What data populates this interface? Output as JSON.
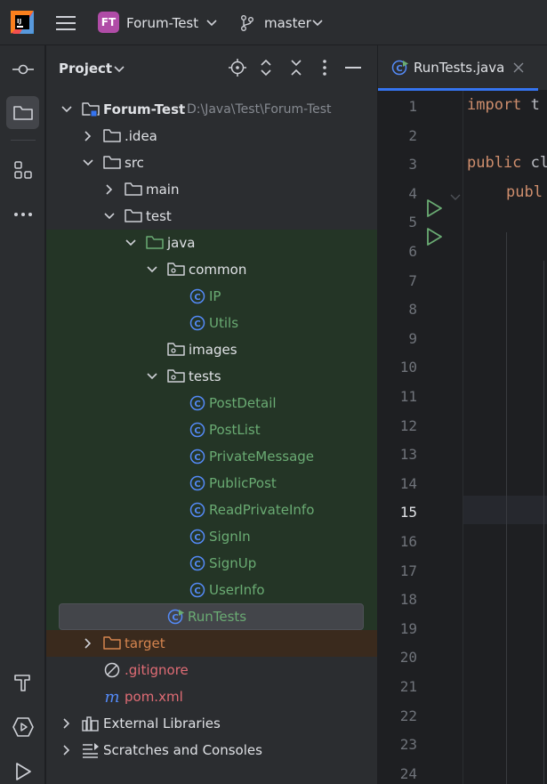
{
  "topbar": {
    "project_badge": "FT",
    "project_name": "Forum-Test",
    "branch": "master"
  },
  "panel": {
    "title": "Project"
  },
  "tree": [
    {
      "label": "Forum-Test",
      "path": "D:\\Java\\Test\\Forum-Test"
    },
    {
      "label": ".idea"
    },
    {
      "label": "src"
    },
    {
      "label": "main"
    },
    {
      "label": "test"
    },
    {
      "label": "java"
    },
    {
      "label": "common"
    },
    {
      "label": "IP"
    },
    {
      "label": "Utils"
    },
    {
      "label": "images"
    },
    {
      "label": "tests"
    },
    {
      "label": "PostDetail"
    },
    {
      "label": "PostList"
    },
    {
      "label": "PrivateMessage"
    },
    {
      "label": "PublicPost"
    },
    {
      "label": "ReadPrivateInfo"
    },
    {
      "label": "SignIn"
    },
    {
      "label": "SignUp"
    },
    {
      "label": "UserInfo"
    },
    {
      "label": "RunTests"
    },
    {
      "label": "target"
    },
    {
      "label": ".gitignore"
    },
    {
      "label": "pom.xml"
    },
    {
      "label": "External Libraries"
    },
    {
      "label": "Scratches and Consoles"
    }
  ],
  "editor": {
    "tab_label": "RunTests.java",
    "line_numbers": [
      "1",
      "2",
      "3",
      "4",
      "5",
      "6",
      "7",
      "8",
      "9",
      "10",
      "11",
      "12",
      "13",
      "14",
      "15",
      "16",
      "17",
      "18",
      "19",
      "20",
      "21",
      "22",
      "23",
      "24"
    ],
    "current_line": "15",
    "code": {
      "line1_kw": "import",
      "line1_rest": " t",
      "line3_kw": "public",
      "line3_rest": " cl",
      "line4_kw": "publ"
    }
  },
  "colors": {
    "accent": "#3574f0",
    "test_folder_bg": "#243526",
    "excluded_folder_bg": "#3a2a1d",
    "project_badge": "#b04ca7"
  }
}
